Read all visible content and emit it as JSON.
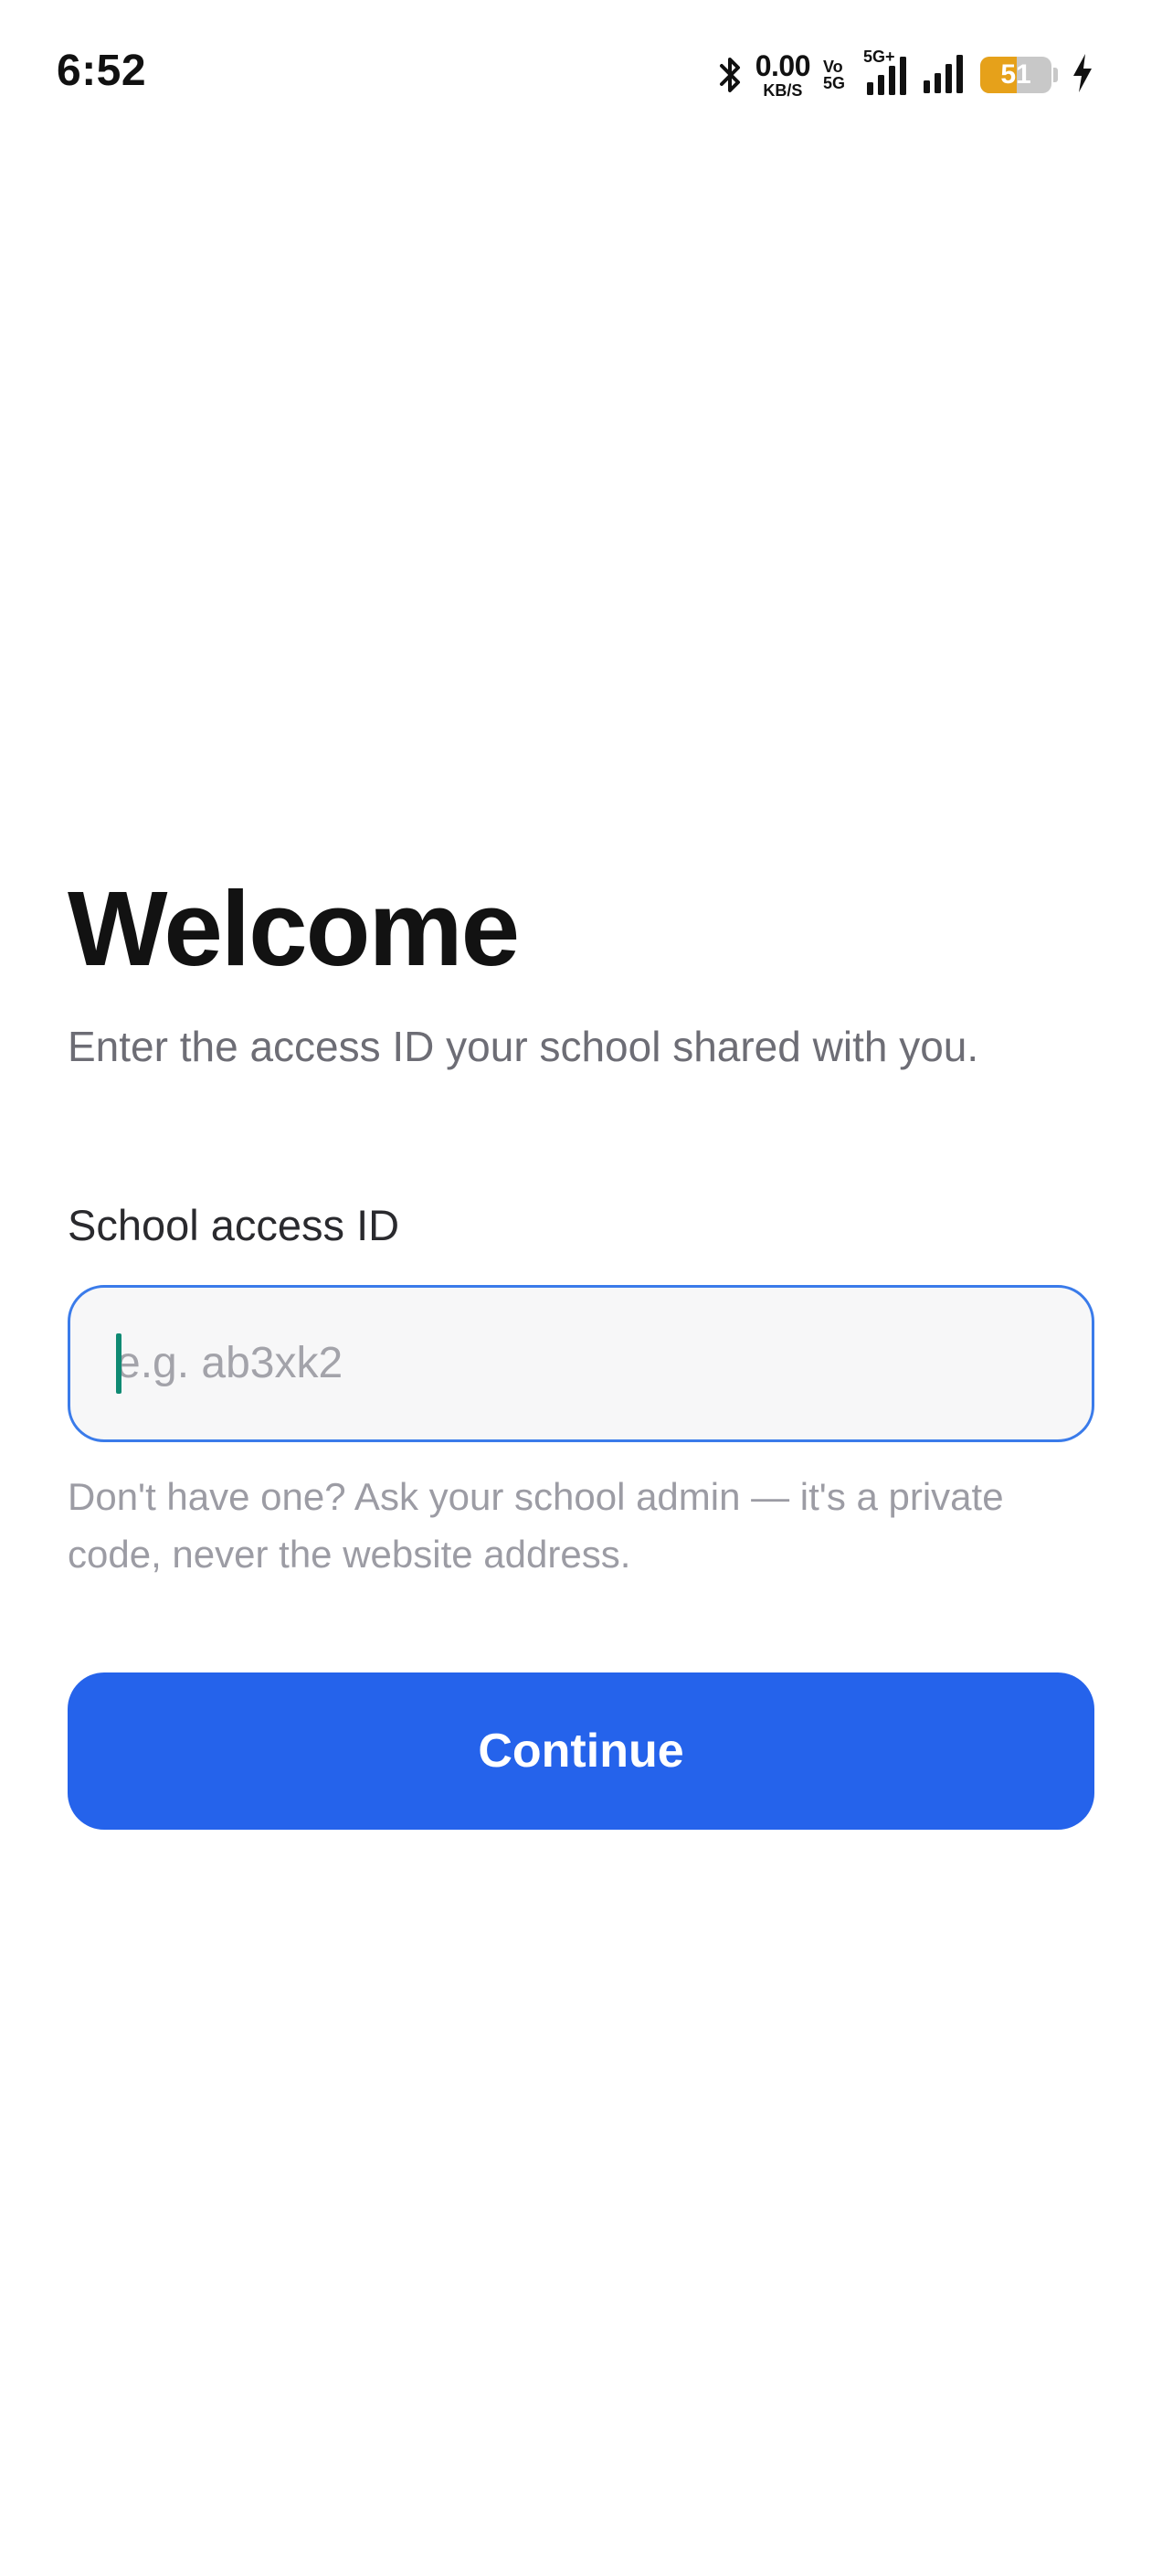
{
  "status_bar": {
    "time": "6:52",
    "net_speed_value": "0.00",
    "net_speed_unit": "KB/S",
    "volte_top": "Vo",
    "volte_bottom": "5G",
    "signal_tag": "5G+",
    "battery_level": "51",
    "battery_percent": 51,
    "battery_color": "#e6a11a",
    "icons": [
      "bluetooth-icon",
      "signal-5g-icon",
      "signal-icon",
      "battery-icon",
      "charging-icon"
    ]
  },
  "welcome": {
    "title": "Welcome",
    "subtitle": "Enter the access ID your school shared with you."
  },
  "form": {
    "label": "School access ID",
    "input_value": "",
    "input_placeholder": "e.g. ab3xk2",
    "help_text": "Don't have one? Ask your school admin — it's a private code, never the website address.",
    "continue_label": "Continue"
  },
  "colors": {
    "accent": "#2563eb",
    "input_border": "#3a7bea",
    "caret": "#0f8a73"
  }
}
